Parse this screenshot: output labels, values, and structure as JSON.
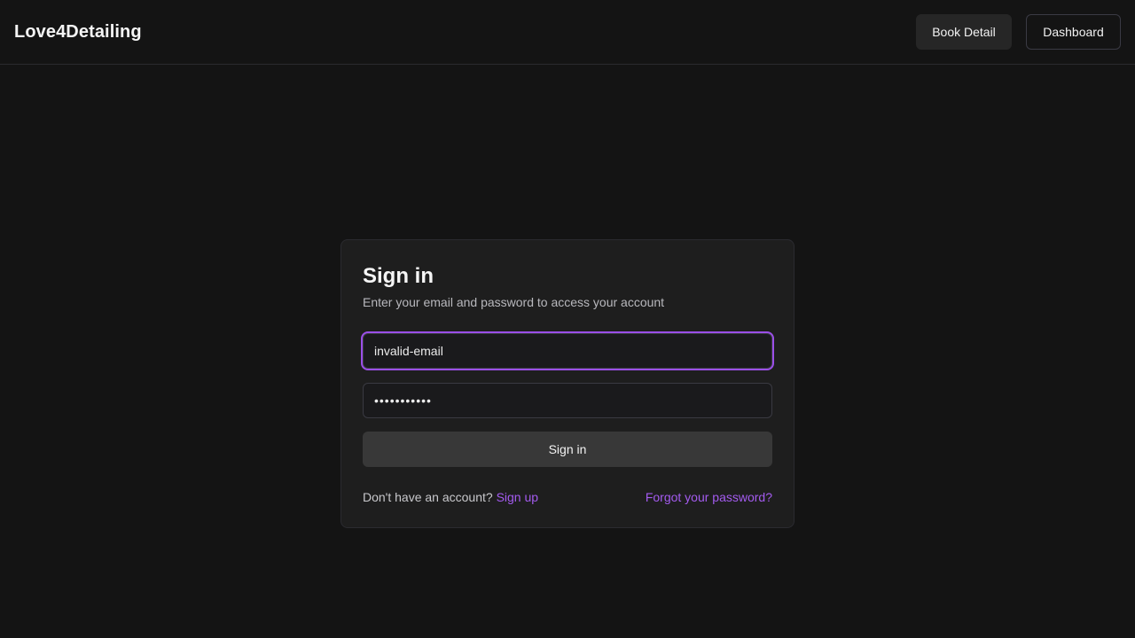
{
  "header": {
    "brand": "Love4Detailing",
    "book_label": "Book Detail",
    "dashboard_label": "Dashboard"
  },
  "signin": {
    "title": "Sign in",
    "subtitle": "Enter your email and password to access your account",
    "email_value": "invalid-email",
    "password_value": "•••••••••••",
    "submit_label": "Sign in",
    "no_account_text": "Don't have an account?",
    "signup_link": "Sign up",
    "forgot_link": "Forgot your password?"
  },
  "colors": {
    "background": "#141414",
    "card": "#1e1e1e",
    "accent": "#9b4fe8",
    "link": "#a45bf0"
  }
}
